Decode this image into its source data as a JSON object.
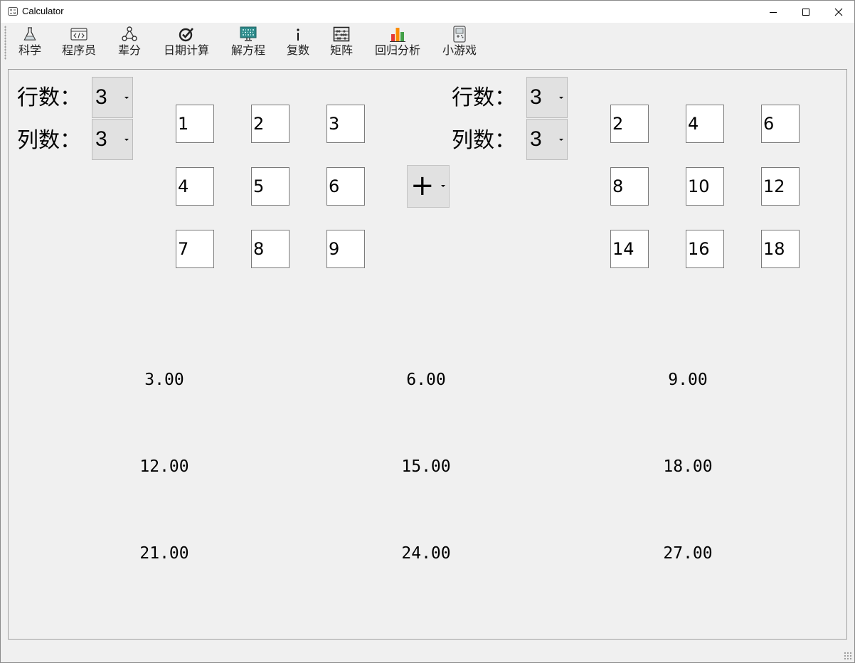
{
  "window": {
    "title": "Calculator"
  },
  "toolbar": {
    "items": [
      {
        "label": "科学",
        "icon": "flask-icon"
      },
      {
        "label": "程序员",
        "icon": "code-window-icon"
      },
      {
        "label": "辈分",
        "icon": "family-tree-icon"
      },
      {
        "label": "日期计算",
        "icon": "calendar-check-icon"
      },
      {
        "label": "解方程",
        "icon": "binary-monitor-icon"
      },
      {
        "label": "复数",
        "icon": "imaginary-i-icon"
      },
      {
        "label": "矩阵",
        "icon": "abacus-icon"
      },
      {
        "label": "回归分析",
        "icon": "bar-chart-icon"
      },
      {
        "label": "小游戏",
        "icon": "game-device-icon"
      }
    ]
  },
  "matrix_a": {
    "rows_label": "行数：",
    "cols_label": "列数：",
    "rows": "3",
    "cols": "3",
    "cells": [
      "1",
      "2",
      "3",
      "4",
      "5",
      "6",
      "7",
      "8",
      "9"
    ]
  },
  "operator": "+",
  "matrix_b": {
    "rows_label": "行数：",
    "cols_label": "列数：",
    "rows": "3",
    "cols": "3",
    "cells": [
      "2",
      "4",
      "6",
      "8",
      "10",
      "12",
      "14",
      "16",
      "18"
    ]
  },
  "result": [
    "3.00",
    "6.00",
    "9.00",
    "12.00",
    "15.00",
    "18.00",
    "21.00",
    "24.00",
    "27.00"
  ]
}
